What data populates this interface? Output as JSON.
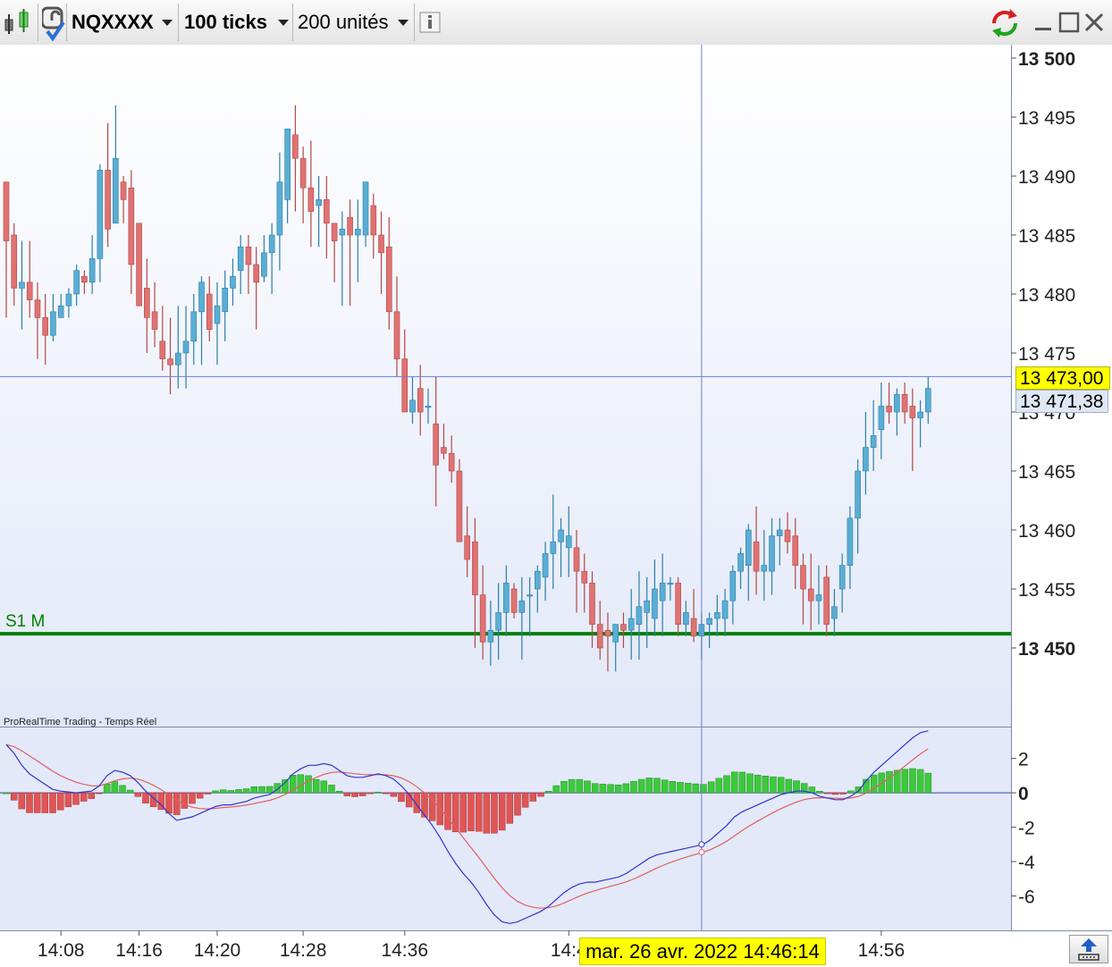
{
  "toolbar": {
    "instrument": "NQXXXX",
    "interval": "100 ticks",
    "units": "200 unités"
  },
  "indicator_label": "ProRealTime Trading - Temps Réel",
  "crosshair": {
    "date_label": "mar. 26 avr. 2022 14:46:14",
    "price_label": "13 473,00",
    "price": 13473.0
  },
  "last_price": {
    "label": "13 471,38",
    "value": 13471.38
  },
  "support": {
    "label": "S1 M",
    "value": 13451.2,
    "color": "#008000"
  },
  "colors": {
    "up": "#5aaed3",
    "down": "#e07272",
    "hist_up": "#3dc93d",
    "hist_down": "#e05555",
    "macd": "#3333cc",
    "signal": "#e06060"
  },
  "chart_data": [
    {
      "type": "candlestick",
      "ylim": [
        13443,
        13503
      ],
      "yticks": [
        {
          "v": 13500,
          "t": "13 500"
        },
        {
          "v": 13495,
          "t": "13 495"
        },
        {
          "v": 13490,
          "t": "13 490"
        },
        {
          "v": 13485,
          "t": "13 485"
        },
        {
          "v": 13480,
          "t": "13 480"
        },
        {
          "v": 13475,
          "t": "13 475"
        },
        {
          "v": 13470,
          "t": "13 470"
        },
        {
          "v": 13465,
          "t": "13 465"
        },
        {
          "v": 13460,
          "t": "13 460"
        },
        {
          "v": 13455,
          "t": "13 455"
        },
        {
          "v": 13450,
          "t": "13 450"
        }
      ],
      "xticks": [
        {
          "i": 7,
          "t": "14:08"
        },
        {
          "i": 17,
          "t": "14:16"
        },
        {
          "i": 27,
          "t": "14:20"
        },
        {
          "i": 38,
          "t": "14:28"
        },
        {
          "i": 51,
          "t": "14:36"
        },
        {
          "i": 72,
          "t": "14:4"
        },
        {
          "i": 112,
          "t": "14:56"
        }
      ],
      "candles": [
        [
          13489.5,
          13489.5,
          13478,
          13484.5
        ],
        [
          13485.0,
          13486.0,
          13479,
          13480.5
        ],
        [
          13480.5,
          13484.5,
          13477,
          13481.0
        ],
        [
          13481.0,
          13484.5,
          13478,
          13479.5
        ],
        [
          13479.5,
          13481.0,
          13474.5,
          13478.0
        ],
        [
          13478.0,
          13480.0,
          13474,
          13476.5
        ],
        [
          13476.5,
          13480.0,
          13476,
          13478.5
        ],
        [
          13478.0,
          13480.0,
          13478,
          13479.0
        ],
        [
          13479.0,
          13480.5,
          13478,
          13480.0
        ],
        [
          13480.0,
          13482.5,
          13479,
          13482.0
        ],
        [
          13481.5,
          13482.0,
          13480.0,
          13481.0
        ],
        [
          13481.0,
          13485.0,
          13480,
          13483.0
        ],
        [
          13483.0,
          13491.0,
          13481,
          13490.5
        ],
        [
          13490.5,
          13494.5,
          13484,
          13485.5
        ],
        [
          13486.0,
          13496.0,
          13488,
          13491.5
        ],
        [
          13489.5,
          13490.0,
          13486,
          13488.0
        ],
        [
          13489.0,
          13490.5,
          13480,
          13482.5
        ],
        [
          13486.0,
          13486.0,
          13479,
          13479.0
        ],
        [
          13480.5,
          13483.0,
          13475,
          13478.0
        ],
        [
          13478.5,
          13481.0,
          13475.5,
          13477.0
        ],
        [
          13476.0,
          13479.0,
          13473.5,
          13474.5
        ],
        [
          13474.5,
          13478.0,
          13471.5,
          13474.0
        ],
        [
          13474.0,
          13479.0,
          13472,
          13475.0
        ],
        [
          13475.0,
          13479.0,
          13472,
          13476.0
        ],
        [
          13476.0,
          13480.0,
          13474,
          13478.5
        ],
        [
          13478.5,
          13481.5,
          13474,
          13481.0
        ],
        [
          13480.0,
          13481.5,
          13476,
          13477.0
        ],
        [
          13477.5,
          13481.0,
          13474,
          13479.0
        ],
        [
          13478.5,
          13482.0,
          13476,
          13480.5
        ],
        [
          13480.5,
          13483.0,
          13479,
          13481.5
        ],
        [
          13482.0,
          13485.0,
          13480,
          13484.0
        ],
        [
          13484.0,
          13485.0,
          13480,
          13482.5
        ],
        [
          13482.5,
          13484.0,
          13477,
          13481.0
        ],
        [
          13481.5,
          13485.0,
          13481,
          13483.5
        ],
        [
          13483.5,
          13486.0,
          13480,
          13485.0
        ],
        [
          13485.0,
          13492.0,
          13482,
          13489.5
        ],
        [
          13488.0,
          13494.0,
          13486,
          13494.0
        ],
        [
          13493.5,
          13496.0,
          13487,
          13491.5
        ],
        [
          13491.5,
          13492.5,
          13486,
          13489.0
        ],
        [
          13489.0,
          13493.0,
          13484,
          13487.0
        ],
        [
          13487.5,
          13490.0,
          13484,
          13488.0
        ],
        [
          13488.0,
          13490.0,
          13483,
          13486.0
        ],
        [
          13486.0,
          13486.0,
          13481,
          13484.5
        ],
        [
          13485.0,
          13487.0,
          13479,
          13485.5
        ],
        [
          13486.5,
          13488.0,
          13479,
          13485.0
        ],
        [
          13485.0,
          13488.0,
          13481,
          13485.5
        ],
        [
          13485.0,
          13489.5,
          13484,
          13489.5
        ],
        [
          13487.5,
          13488.5,
          13483,
          13485.0
        ],
        [
          13485.0,
          13487.0,
          13480,
          13483.5
        ],
        [
          13484.0,
          13486.5,
          13477,
          13478.5
        ],
        [
          13478.5,
          13481.5,
          13473,
          13474.5
        ],
        [
          13474.5,
          13477.0,
          13470,
          13470.0
        ],
        [
          13470.0,
          13473.0,
          13469,
          13471.0
        ],
        [
          13472.0,
          13474.0,
          13468,
          13470.0
        ],
        [
          13470.5,
          13472.0,
          13469,
          13470.5
        ],
        [
          13469.0,
          13473.0,
          13462,
          13465.5
        ],
        [
          13467.0,
          13469.0,
          13466,
          13466.5
        ],
        [
          13466.5,
          13468.0,
          13464,
          13465.0
        ],
        [
          13465.0,
          13466.0,
          13460,
          13459.0
        ],
        [
          13459.5,
          13462.0,
          13456,
          13457.5
        ],
        [
          13459.0,
          13461.0,
          13450,
          13454.5
        ],
        [
          13454.5,
          13457.0,
          13449,
          13450.5
        ],
        [
          13450.5,
          13454.0,
          13448.5,
          13451.5
        ],
        [
          13451.5,
          13455.5,
          13449,
          13453.0
        ],
        [
          13453.0,
          13457.0,
          13451,
          13455.5
        ],
        [
          13455.0,
          13455.5,
          13452.5,
          13453.0
        ],
        [
          13453.0,
          13456.0,
          13449,
          13454.0
        ],
        [
          13454.5,
          13456.0,
          13451,
          13454.5
        ],
        [
          13455.0,
          13457.0,
          13453,
          13456.5
        ],
        [
          13456.0,
          13459.0,
          13454,
          13458.0
        ],
        [
          13458.0,
          13463.0,
          13455,
          13459.0
        ],
        [
          13459.0,
          13461.0,
          13456,
          13460.0
        ],
        [
          13458.5,
          13462.0,
          13456,
          13459.5
        ],
        [
          13458.5,
          13460.0,
          13453,
          13456.5
        ],
        [
          13456.5,
          13458.0,
          13453,
          13455.5
        ],
        [
          13455.5,
          13456.5,
          13450,
          13452.0
        ],
        [
          13452.0,
          13454.0,
          13449,
          13450.0
        ],
        [
          13451.5,
          13453.0,
          13448,
          13451.0
        ],
        [
          13450.5,
          13452.0,
          13448,
          13452.0
        ],
        [
          13452.0,
          13453.0,
          13450,
          13451.5
        ],
        [
          13451.5,
          13455.0,
          13449,
          13452.5
        ],
        [
          13452.0,
          13456.5,
          13449,
          13453.5
        ],
        [
          13453.0,
          13456.0,
          13450,
          13454.0
        ],
        [
          13452.5,
          13457.5,
          13451,
          13455.0
        ],
        [
          13454.0,
          13458.0,
          13451,
          13455.5
        ],
        [
          13455.5,
          13456.0,
          13454,
          13455.5
        ],
        [
          13455.5,
          13456.0,
          13451,
          13452.0
        ],
        [
          13452.0,
          13454.0,
          13451,
          13453.0
        ],
        [
          13452.5,
          13455.0,
          13450.5,
          13451.0
        ],
        [
          13451.0,
          13453.0,
          13449,
          13452.0
        ],
        [
          13452.0,
          13453.0,
          13450,
          13452.5
        ],
        [
          13452.5,
          13454.5,
          13451,
          13453.0
        ],
        [
          13452.5,
          13455.0,
          13451,
          13454.0
        ],
        [
          13454.0,
          13457.0,
          13452,
          13456.5
        ],
        [
          13456.5,
          13458.5,
          13455,
          13458.0
        ],
        [
          13457.0,
          13460.5,
          13454,
          13460.0
        ],
        [
          13459.0,
          13462.0,
          13454.5,
          13456.5
        ],
        [
          13456.5,
          13460.0,
          13454,
          13457.0
        ],
        [
          13456.5,
          13461.0,
          13454.5,
          13459.5
        ],
        [
          13459.5,
          13461.0,
          13457,
          13460.0
        ],
        [
          13460.0,
          13461.5,
          13458,
          13459.0
        ],
        [
          13459.5,
          13461.0,
          13455,
          13457.0
        ],
        [
          13457.0,
          13458.0,
          13452,
          13455.0
        ],
        [
          13455.0,
          13458.0,
          13451.5,
          13454.0
        ],
        [
          13454.0,
          13457.0,
          13452,
          13454.5
        ],
        [
          13456.0,
          13457.0,
          13451,
          13452.0
        ],
        [
          13452.5,
          13455.0,
          13451,
          13453.5
        ],
        [
          13455.0,
          13458.0,
          13453,
          13457.0
        ],
        [
          13457.0,
          13462.0,
          13455,
          13461.0
        ],
        [
          13461.0,
          13466.0,
          13458,
          13465.0
        ],
        [
          13465.0,
          13470.0,
          13463,
          13467.0
        ],
        [
          13467.0,
          13471.0,
          13465,
          13468.0
        ],
        [
          13468.5,
          13472.5,
          13466,
          13470.5
        ],
        [
          13470.5,
          13472.5,
          13469,
          13470.0
        ],
        [
          13470.0,
          13472.0,
          13468,
          13471.5
        ],
        [
          13471.5,
          13472.5,
          13469,
          13470.0
        ],
        [
          13470.5,
          13472.0,
          13465,
          13469.5
        ],
        [
          13469.5,
          13471.0,
          13467,
          13470.0
        ],
        [
          13470.0,
          13473.0,
          13469,
          13472.0
        ]
      ]
    },
    {
      "type": "line+bar",
      "ylim": [
        -8,
        3.8
      ],
      "yticks": [
        {
          "v": 2,
          "t": "2"
        },
        {
          "v": 0,
          "t": "0"
        },
        {
          "v": -2,
          "t": "-2"
        },
        {
          "v": -4,
          "t": "-4"
        },
        {
          "v": -6,
          "t": "-6"
        }
      ],
      "series_macd": [
        2.8,
        2.3,
        1.6,
        1.1,
        0.8,
        0.5,
        0.2,
        0.1,
        0.05,
        0.0,
        0.05,
        0.1,
        0.4,
        1.0,
        1.3,
        1.2,
        1.0,
        0.6,
        0.1,
        -0.3,
        -0.7,
        -1.2,
        -1.6,
        -1.5,
        -1.4,
        -1.2,
        -1.0,
        -0.8,
        -0.7,
        -0.7,
        -0.6,
        -0.5,
        -0.3,
        -0.2,
        -0.1,
        0.2,
        0.6,
        1.1,
        1.4,
        1.6,
        1.6,
        1.7,
        1.6,
        1.3,
        1.0,
        0.9,
        0.9,
        1.0,
        1.1,
        1.0,
        0.8,
        0.4,
        -0.1,
        -0.7,
        -1.3,
        -1.9,
        -2.6,
        -3.4,
        -4.1,
        -4.7,
        -5.2,
        -5.8,
        -6.5,
        -7.1,
        -7.5,
        -7.6,
        -7.5,
        -7.3,
        -7.1,
        -6.9,
        -6.6,
        -6.2,
        -5.8,
        -5.5,
        -5.3,
        -5.2,
        -5.2,
        -5.1,
        -5.0,
        -4.9,
        -4.7,
        -4.4,
        -4.1,
        -3.8,
        -3.6,
        -3.5,
        -3.4,
        -3.3,
        -3.2,
        -3.1,
        -3.0,
        -2.7,
        -2.3,
        -1.9,
        -1.4,
        -1.1,
        -0.9,
        -0.7,
        -0.5,
        -0.3,
        -0.1,
        0.0,
        0.1,
        0.1,
        0.0,
        -0.2,
        -0.3,
        -0.4,
        -0.4,
        -0.2,
        0.1,
        0.7,
        1.2,
        1.6,
        2.0,
        2.4,
        2.8,
        3.2,
        3.5,
        3.6
      ]
    }
  ]
}
